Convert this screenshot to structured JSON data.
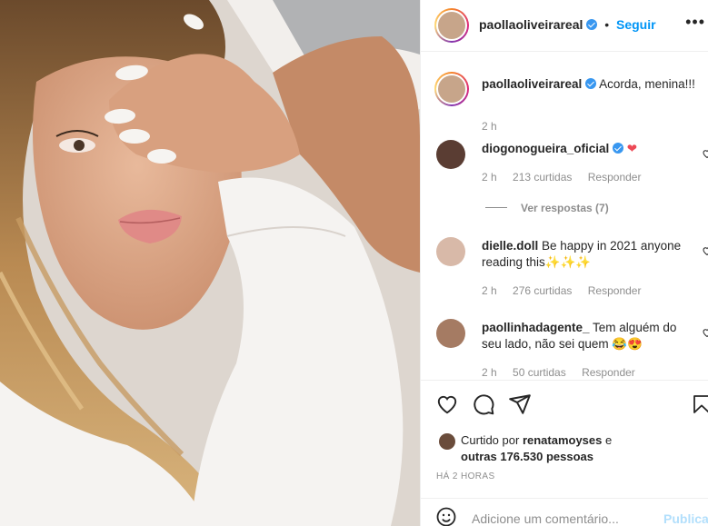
{
  "post": {
    "username": "paollaoliveirareal",
    "follow_label": "Seguir",
    "separator": "•",
    "more_label": "•••",
    "caption": "Acorda, menina!!!",
    "caption_time": "2 h"
  },
  "comments": [
    {
      "username": "diogonogueira_oficial",
      "text": "❤",
      "time": "2 h",
      "likes": "213 curtidas",
      "reply": "Responder",
      "verified": true
    },
    {
      "username": "dielle.doll",
      "text": "Be happy in 2021 anyone reading this✨✨✨",
      "time": "2 h",
      "likes": "276 curtidas",
      "reply": "Responder"
    },
    {
      "username": "paollinhadagente_",
      "text": "Tem alguém do seu lado, não sei quem 😂😍",
      "time": "2 h",
      "likes": "50 curtidas",
      "reply": "Responder"
    }
  ],
  "view_replies": "Ver respostas (7)",
  "likes": {
    "prefix": "Curtido por",
    "user": "renatamoyses",
    "conj": "e",
    "others": "outras 176.530 pessoas"
  },
  "timestamp": "HÁ 2 HORAS",
  "add_comment": {
    "placeholder": "Adicione um comentário...",
    "publish": "Publicar"
  },
  "colors": {
    "accent": "#0095f6",
    "verified": "#3897f0",
    "muted": "#8e8e8e",
    "heart": "#ed4956"
  }
}
